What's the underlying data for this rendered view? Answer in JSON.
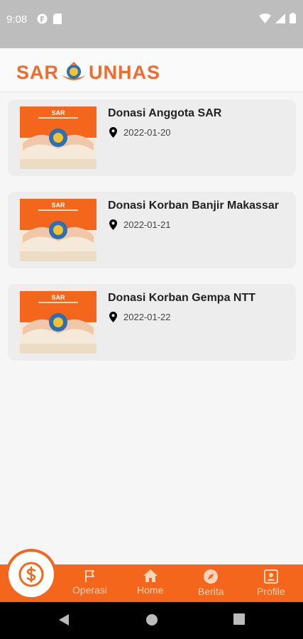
{
  "status_bar": {
    "time": "9:08"
  },
  "header": {
    "logo_left": "SAR",
    "logo_right": "UNHAS"
  },
  "donations": [
    {
      "title": "Donasi Anggota SAR",
      "date": "2022-01-20",
      "thumb_caption": "SAR"
    },
    {
      "title": "Donasi Korban Banjir Makassar",
      "date": "2022-01-21",
      "thumb_caption": "SAR"
    },
    {
      "title": "Donasi Korban Gempa NTT",
      "date": "2022-01-22",
      "thumb_caption": "SAR"
    }
  ],
  "bottom_nav": {
    "items": [
      {
        "label": "Operasi",
        "icon": "flag-icon"
      },
      {
        "label": "Home",
        "icon": "home-icon"
      },
      {
        "label": "Berita",
        "icon": "compass-icon"
      },
      {
        "label": "Profile",
        "icon": "profile-card-icon"
      }
    ],
    "fab_icon": "dollar-icon"
  },
  "colors": {
    "accent": "#f4661b",
    "logo": "#f26a2e",
    "card_bg": "#ededed"
  }
}
